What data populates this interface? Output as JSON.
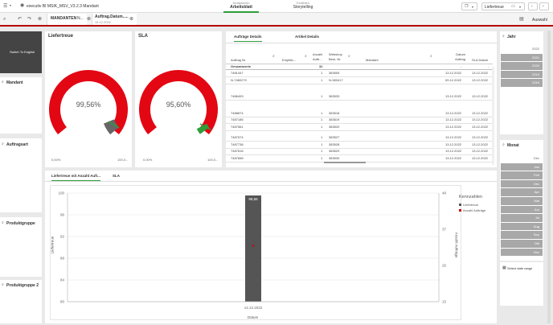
{
  "app": {
    "title": "executiv BI MSIK_MSV_V3.2.3 Mandant",
    "nav": [
      {
        "small": "Analysieren",
        "label": "Arbeitsblatt"
      },
      {
        "small": "Erzählen",
        "label": "Storytelling"
      }
    ],
    "sheet_selector": "Liefertreue",
    "auswahl_label": "Auswahl"
  },
  "selections": [
    {
      "label": "MANDANTEN",
      "value": "N..."
    },
    {
      "label": "Auftrag.Datum.....",
      "value": "14.12.2022"
    }
  ],
  "sidebar": {
    "logo_text": "Switch To English",
    "filters": [
      "Mandant",
      "Auftragsart",
      "Produktgruppe",
      "Produktgruppe 2"
    ]
  },
  "gauges": [
    {
      "title": "Liefertreue",
      "value_label": "99,56%",
      "min_label": "0,00%",
      "max_label": "100,0...",
      "value": 0.9956
    },
    {
      "title": "SLA",
      "value_label": "95,60%",
      "min_label": "0,00%",
      "max_label": "100,0...",
      "value": 0.956
    }
  ],
  "table": {
    "tabs": [
      "Aufträge Details",
      "Artikel Details"
    ],
    "headers": [
      "Auftrag Nr.",
      "Empfän...",
      "Anzahl Auftr...",
      "Webshop Best. Nr.",
      "Mandant",
      "Datum Auftrag",
      "SLA Datum"
    ],
    "total": {
      "label": "Gesamtwerte",
      "count": "32",
      "dash1": "-",
      "dash2": "-"
    },
    "rows": [
      {
        "nr": "7481447",
        "anzahl": "1",
        "webshop": "383505",
        "datum": "13.12.2022",
        "sla": "13.12.2022"
      },
      {
        "nr": "N-7480270",
        "anzahl": "1",
        "webshop": "N-383417",
        "datum": "09.12.2022",
        "sla": "13.12.2022"
      },
      {
        "nr": "7486493",
        "anzahl": "1",
        "webshop": "383533",
        "datum": "13.12.2022",
        "sla": "13.12.2022"
      },
      {
        "nr": "7488874",
        "anzahl": "1",
        "webshop": "383518",
        "datum": "13.12.2022",
        "sla": "13.12.2022"
      },
      {
        "nr": "7487186",
        "anzahl": "1",
        "webshop": "383519",
        "datum": "13.12.2022",
        "sla": "13.12.2022"
      },
      {
        "nr": "7487561",
        "anzahl": "1",
        "webshop": "383520",
        "datum": "13.12.2022",
        "sla": "13.12.2022"
      },
      {
        "nr": "7487574",
        "anzahl": "1",
        "webshop": "383527",
        "datum": "13.12.2022",
        "sla": "13.12.2022"
      },
      {
        "nr": "7487738",
        "anzahl": "1",
        "webshop": "383528",
        "datum": "13.12.2022",
        "sla": "13.12.2022"
      },
      {
        "nr": "7487818",
        "anzahl": "1",
        "webshop": "383529",
        "datum": "13.12.2022",
        "sla": "13.12.2022"
      },
      {
        "nr": "7487658",
        "anzahl": "1",
        "webshop": "383530",
        "datum": "13.12.2022",
        "sla": "13.12.2022"
      }
    ]
  },
  "chart_tabs": [
    "Liefertreue mit Anzahl Auft...",
    "SLA"
  ],
  "chart_data": {
    "type": "bar",
    "categories": [
      "14.12.2022"
    ],
    "series": [
      {
        "name": "Liefertreue",
        "values": [
          99.56
        ],
        "color": "#555555"
      },
      {
        "name": "Anzahl Aufträge",
        "values": [
          32
        ],
        "color": "#cc0000",
        "type": "scatter"
      }
    ],
    "bar_label": "99,56",
    "xlabel": "Datum",
    "ylabel": "Liefertreue",
    "y2label": "Anzahl Aufträge",
    "ylim": [
      80,
      100
    ],
    "y2lim": [
      15,
      48
    ],
    "yticks": [
      80,
      84,
      88,
      92,
      96,
      100
    ],
    "y2ticks": [
      15,
      26,
      37,
      48
    ],
    "legend_title": "Kennzahlen",
    "legend_position": "right"
  },
  "right_panel": {
    "year_title": "Jahr",
    "years": [
      "2022",
      "2021",
      "2020",
      "2019",
      "2018"
    ],
    "month_title": "Monat",
    "months": [
      "Dez",
      "Jan",
      "Feb",
      "Mrz",
      "Apr",
      "Mai",
      "Jun",
      "Jul",
      "Aug",
      "Sep",
      "Okt",
      "Nov"
    ],
    "select_date_label": "Select date range"
  },
  "colors": {
    "accent": "#b50000",
    "gauge_red": "#e30613",
    "gauge_grey": "#666666",
    "gauge_green": "#2e9e3a",
    "selection_grey": "#a8a8a8"
  }
}
